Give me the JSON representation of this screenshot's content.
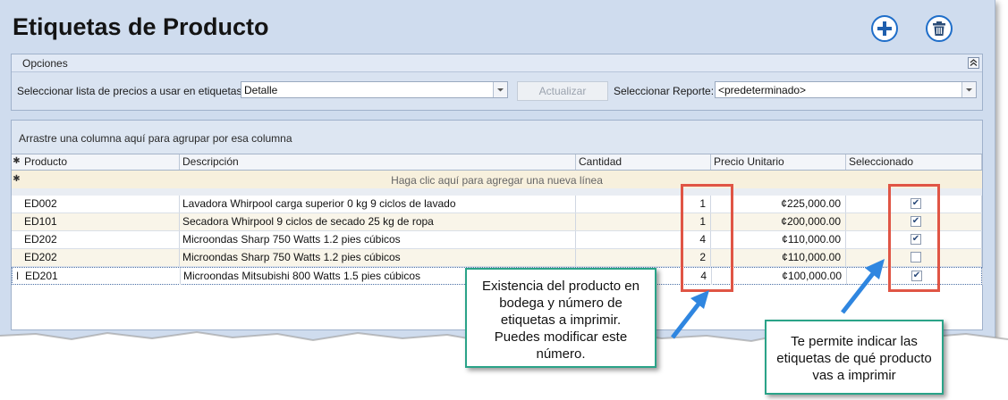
{
  "page": {
    "title": "Etiquetas de Producto",
    "icons": {
      "add": "plus-circle-icon",
      "delete": "trash-icon"
    }
  },
  "options": {
    "title": "Opciones",
    "price_list_label": "Seleccionar lista de precios a usar en etiquetas:",
    "price_list_value": "Detalle",
    "update_button": "Actualizar",
    "report_label": "Seleccionar Reporte:",
    "report_value": "<predeterminado>"
  },
  "grid": {
    "group_hint": "Arrastre una columna aquí para agrupar por esa columna",
    "new_row_hint": "Haga clic aquí para agregar una nueva línea",
    "columns": [
      "Producto",
      "Descripción",
      "Cantidad",
      "Precio Unitario",
      "Seleccionado"
    ],
    "rows": [
      {
        "producto": "ED002",
        "descripcion": "Lavadora Whirpool carga superior 0 kg 9 ciclos de lavado",
        "cantidad": "1",
        "precio": "¢225,000.00",
        "seleccionado": true
      },
      {
        "producto": "ED101",
        "descripcion": "Secadora Whirpool 9 ciclos de secado 25  kg de ropa",
        "cantidad": "1",
        "precio": "¢200,000.00",
        "seleccionado": true
      },
      {
        "producto": "ED202",
        "descripcion": "Microondas Sharp 750 Watts 1.2 pies cúbicos",
        "cantidad": "4",
        "precio": "¢110,000.00",
        "seleccionado": true
      },
      {
        "producto": "ED202",
        "descripcion": "Microondas Sharp 750 Watts 1.2 pies cúbicos",
        "cantidad": "2",
        "precio": "¢110,000.00",
        "seleccionado": false
      },
      {
        "producto": "ED201",
        "descripcion": "Microondas Mitsubishi 800 Watts 1.5 pies cúbicos",
        "cantidad": "4",
        "precio": "¢100,000.00",
        "seleccionado": true
      }
    ],
    "row_indicators": {
      "header": "✱",
      "new_row": "✱",
      "current": "I"
    }
  },
  "callouts": {
    "quantity_note": [
      "Existencia del producto en",
      "bodega y número de",
      "etiquetas a imprimir.",
      "Puedes modificar este",
      "número."
    ],
    "selected_note": [
      "Te permite indicar las",
      "etiquetas de qué producto",
      "vas a imprimir"
    ]
  },
  "colors": {
    "highlight": "#e05545",
    "callout_border": "#2aa388",
    "arrow": "#2f86e0",
    "accent": "#1f6ec9"
  }
}
